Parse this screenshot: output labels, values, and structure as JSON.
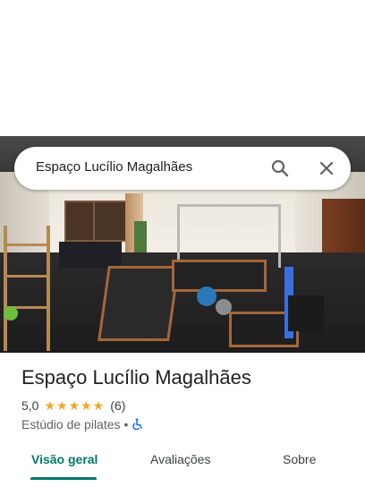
{
  "search": {
    "query": "Espaço Lucílio Magalhães",
    "search_icon": "search-icon",
    "close_icon": "close-icon"
  },
  "place": {
    "name": "Espaço Lucílio Magalhães",
    "rating": "5,0",
    "stars": 5,
    "review_count": "(6)",
    "category": "Estúdio de pilates",
    "separator": "•",
    "accessibility_icon": "wheelchair-icon"
  },
  "tabs": [
    {
      "label": "Visão geral",
      "active": true
    },
    {
      "label": "Avaliações",
      "active": false
    },
    {
      "label": "Sobre",
      "active": false
    }
  ],
  "colors": {
    "accent": "#00796b",
    "star": "#f5a623",
    "accessibility": "#1a73e8"
  }
}
